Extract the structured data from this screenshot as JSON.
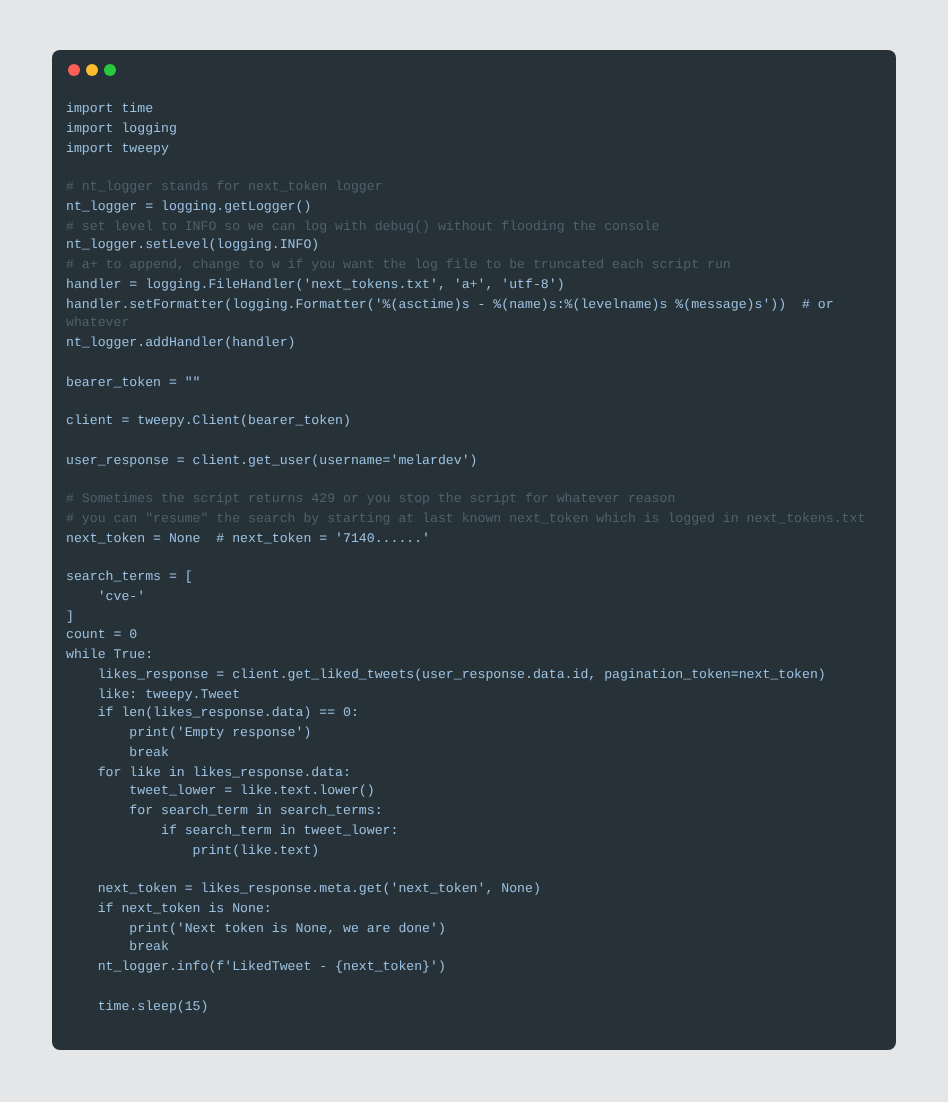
{
  "window": {
    "controls": [
      {
        "color": "#ff5f56"
      },
      {
        "color": "#ffbd2e"
      },
      {
        "color": "#27c93f"
      }
    ]
  },
  "code": [
    {
      "kind": "code",
      "text": "import time"
    },
    {
      "kind": "code",
      "text": "import logging"
    },
    {
      "kind": "code",
      "text": "import tweepy"
    },
    {
      "kind": "blank"
    },
    {
      "kind": "comment",
      "text": "# nt_logger stands for next_token logger"
    },
    {
      "kind": "code",
      "text": "nt_logger = logging.getLogger()"
    },
    {
      "kind": "comment",
      "text": "# set level to INFO so we can log with debug() without flooding the console"
    },
    {
      "kind": "code",
      "text": "nt_logger.setLevel(logging.INFO)"
    },
    {
      "kind": "comment",
      "text": "# a+ to append, change to w if you want the log file to be truncated each script run"
    },
    {
      "kind": "code",
      "text": "handler = logging.FileHandler('next_tokens.txt', 'a+', 'utf-8')"
    },
    {
      "kind": "code",
      "text": "handler.setFormatter(logging.Formatter('%(asctime)s - %(name)s:%(levelname)s %(message)s'))  # or"
    },
    {
      "kind": "comment",
      "text": "whatever"
    },
    {
      "kind": "code",
      "text": "nt_logger.addHandler(handler)"
    },
    {
      "kind": "blank"
    },
    {
      "kind": "code",
      "text": "bearer_token = \"\""
    },
    {
      "kind": "blank"
    },
    {
      "kind": "code",
      "text": "client = tweepy.Client(bearer_token)"
    },
    {
      "kind": "blank"
    },
    {
      "kind": "code",
      "text": "user_response = client.get_user(username='melardev')"
    },
    {
      "kind": "blank"
    },
    {
      "kind": "comment",
      "text": "# Sometimes the script returns 429 or you stop the script for whatever reason"
    },
    {
      "kind": "comment",
      "text": "# you can \"resume\" the search by starting at last known next_token which is logged in next_tokens.txt"
    },
    {
      "kind": "code",
      "text": "next_token = None  # next_token = '7140......'"
    },
    {
      "kind": "blank"
    },
    {
      "kind": "code",
      "text": "search_terms = ["
    },
    {
      "kind": "code",
      "text": "    'cve-'"
    },
    {
      "kind": "code",
      "text": "]"
    },
    {
      "kind": "code",
      "text": "count = 0"
    },
    {
      "kind": "code",
      "text": "while True:"
    },
    {
      "kind": "code",
      "text": "    likes_response = client.get_liked_tweets(user_response.data.id, pagination_token=next_token)"
    },
    {
      "kind": "code",
      "text": "    like: tweepy.Tweet"
    },
    {
      "kind": "code",
      "text": "    if len(likes_response.data) == 0:"
    },
    {
      "kind": "code",
      "text": "        print('Empty response')"
    },
    {
      "kind": "code",
      "text": "        break"
    },
    {
      "kind": "code",
      "text": "    for like in likes_response.data:"
    },
    {
      "kind": "code",
      "text": "        tweet_lower = like.text.lower()"
    },
    {
      "kind": "code",
      "text": "        for search_term in search_terms:"
    },
    {
      "kind": "code",
      "text": "            if search_term in tweet_lower:"
    },
    {
      "kind": "code",
      "text": "                print(like.text)"
    },
    {
      "kind": "blank"
    },
    {
      "kind": "code",
      "text": "    next_token = likes_response.meta.get('next_token', None)"
    },
    {
      "kind": "code",
      "text": "    if next_token is None:"
    },
    {
      "kind": "code",
      "text": "        print('Next token is None, we are done')"
    },
    {
      "kind": "code",
      "text": "        break"
    },
    {
      "kind": "code",
      "text": "    nt_logger.info(f'LikedTweet - {next_token}')"
    },
    {
      "kind": "blank"
    },
    {
      "kind": "code",
      "text": "    time.sleep(15)"
    }
  ]
}
